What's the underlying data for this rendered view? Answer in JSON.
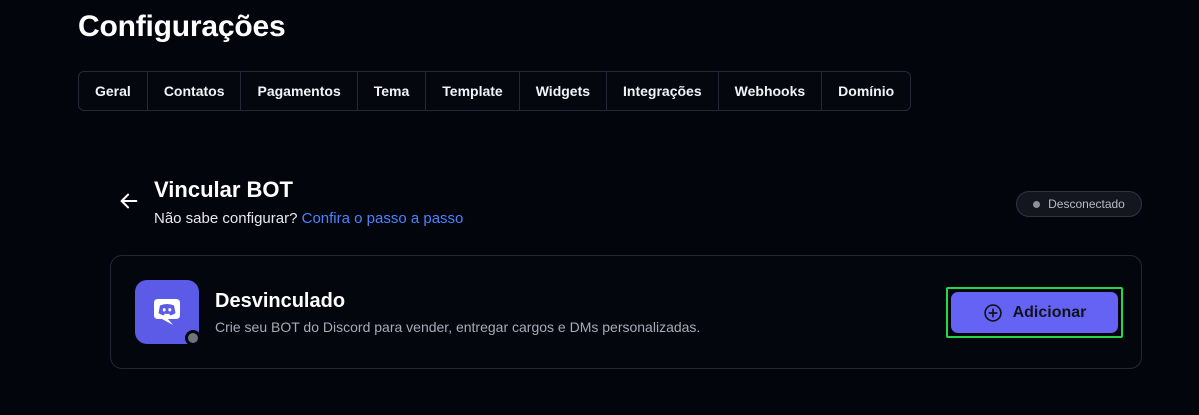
{
  "page": {
    "title": "Configurações"
  },
  "tabs": [
    {
      "label": "Geral"
    },
    {
      "label": "Contatos"
    },
    {
      "label": "Pagamentos"
    },
    {
      "label": "Tema"
    },
    {
      "label": "Template"
    },
    {
      "label": "Widgets"
    },
    {
      "label": "Integrações"
    },
    {
      "label": "Webhooks"
    },
    {
      "label": "Domínio"
    }
  ],
  "section": {
    "title": "Vincular BOT",
    "help_text": "Não sabe configurar?",
    "help_link": "Confira o passo a passo",
    "back_icon": "arrow-left-icon"
  },
  "status": {
    "label": "Desconectado",
    "color": "#8d919c"
  },
  "bot_card": {
    "title": "Desvinculado",
    "description": "Crie seu BOT do Discord para vender, entregar cargos e DMs personalizadas.",
    "icon": "discord-icon",
    "add_button_label": "Adicionar",
    "add_icon": "plus-circle-icon"
  },
  "colors": {
    "background": "#03050c",
    "accent": "#6563f3",
    "link": "#4b82ff",
    "discord": "#5b5be8",
    "highlight": "#22d84a"
  }
}
